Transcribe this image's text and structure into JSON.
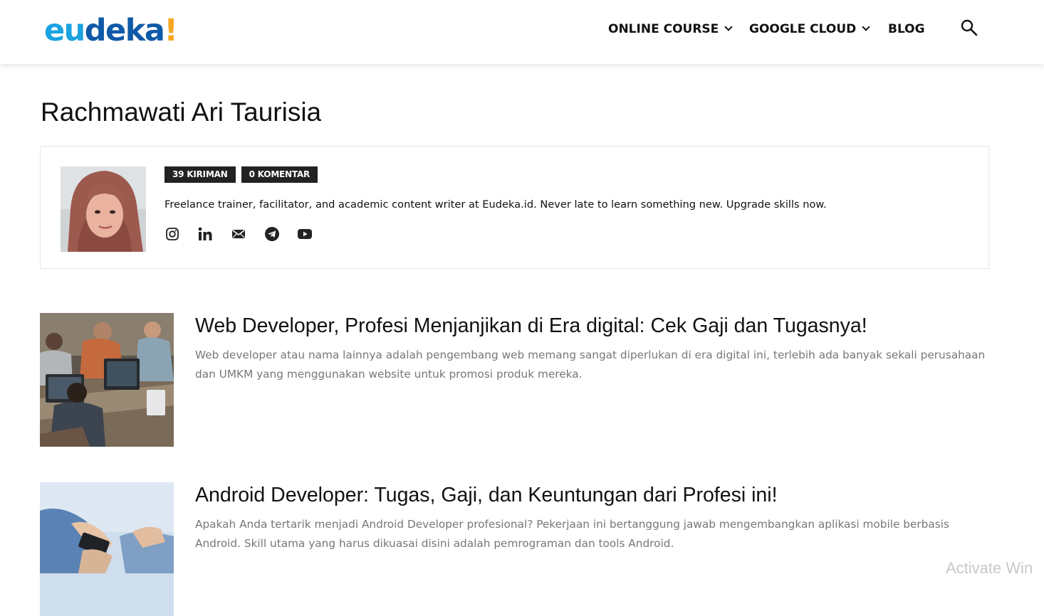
{
  "header": {
    "logo": {
      "part1": "eu",
      "part2": "deka",
      "mark": "!",
      "colors": {
        "primary": "#1aa3e0",
        "secondary": "#0f5aa8",
        "accent": "#f7a823"
      }
    },
    "nav": [
      {
        "label": "ONLINE COURSE",
        "has_dropdown": true
      },
      {
        "label": "GOOGLE CLOUD",
        "has_dropdown": true
      },
      {
        "label": "BLOG",
        "has_dropdown": false
      }
    ],
    "search_icon": "search-icon"
  },
  "author": {
    "name": "Rachmawati Ari Taurisia",
    "posts_badge": "39 KIRIMAN",
    "comments_badge": "0 KOMENTAR",
    "bio": "Freelance trainer, facilitator, and academic content writer at Eudeka.id. Never late to learn something new. Upgrade skills now.",
    "socials": [
      "instagram-icon",
      "linkedin-icon",
      "mail-icon",
      "telegram-icon",
      "youtube-icon"
    ]
  },
  "posts": [
    {
      "title": "Web Developer, Profesi Menjanjikan di Era digital: Cek Gaji dan Tugasnya!",
      "excerpt": "Web developer atau nama lainnya adalah pengembang web memang sangat diperlukan di era digital ini, terlebih ada banyak sekali perusahaan dan UMKM yang menggunakan website untuk promosi produk mereka."
    },
    {
      "title": "Android Developer: Tugas, Gaji, dan Keuntungan dari Profesi ini!",
      "excerpt": "Apakah Anda tertarik menjadi Android Developer profesional? Pekerjaan ini bertanggung jawab mengembangkan aplikasi mobile berbasis Android. Skill utama yang harus dikuasai disini adalah pemrograman dan tools Android."
    }
  ],
  "watermark": "Activate Win"
}
